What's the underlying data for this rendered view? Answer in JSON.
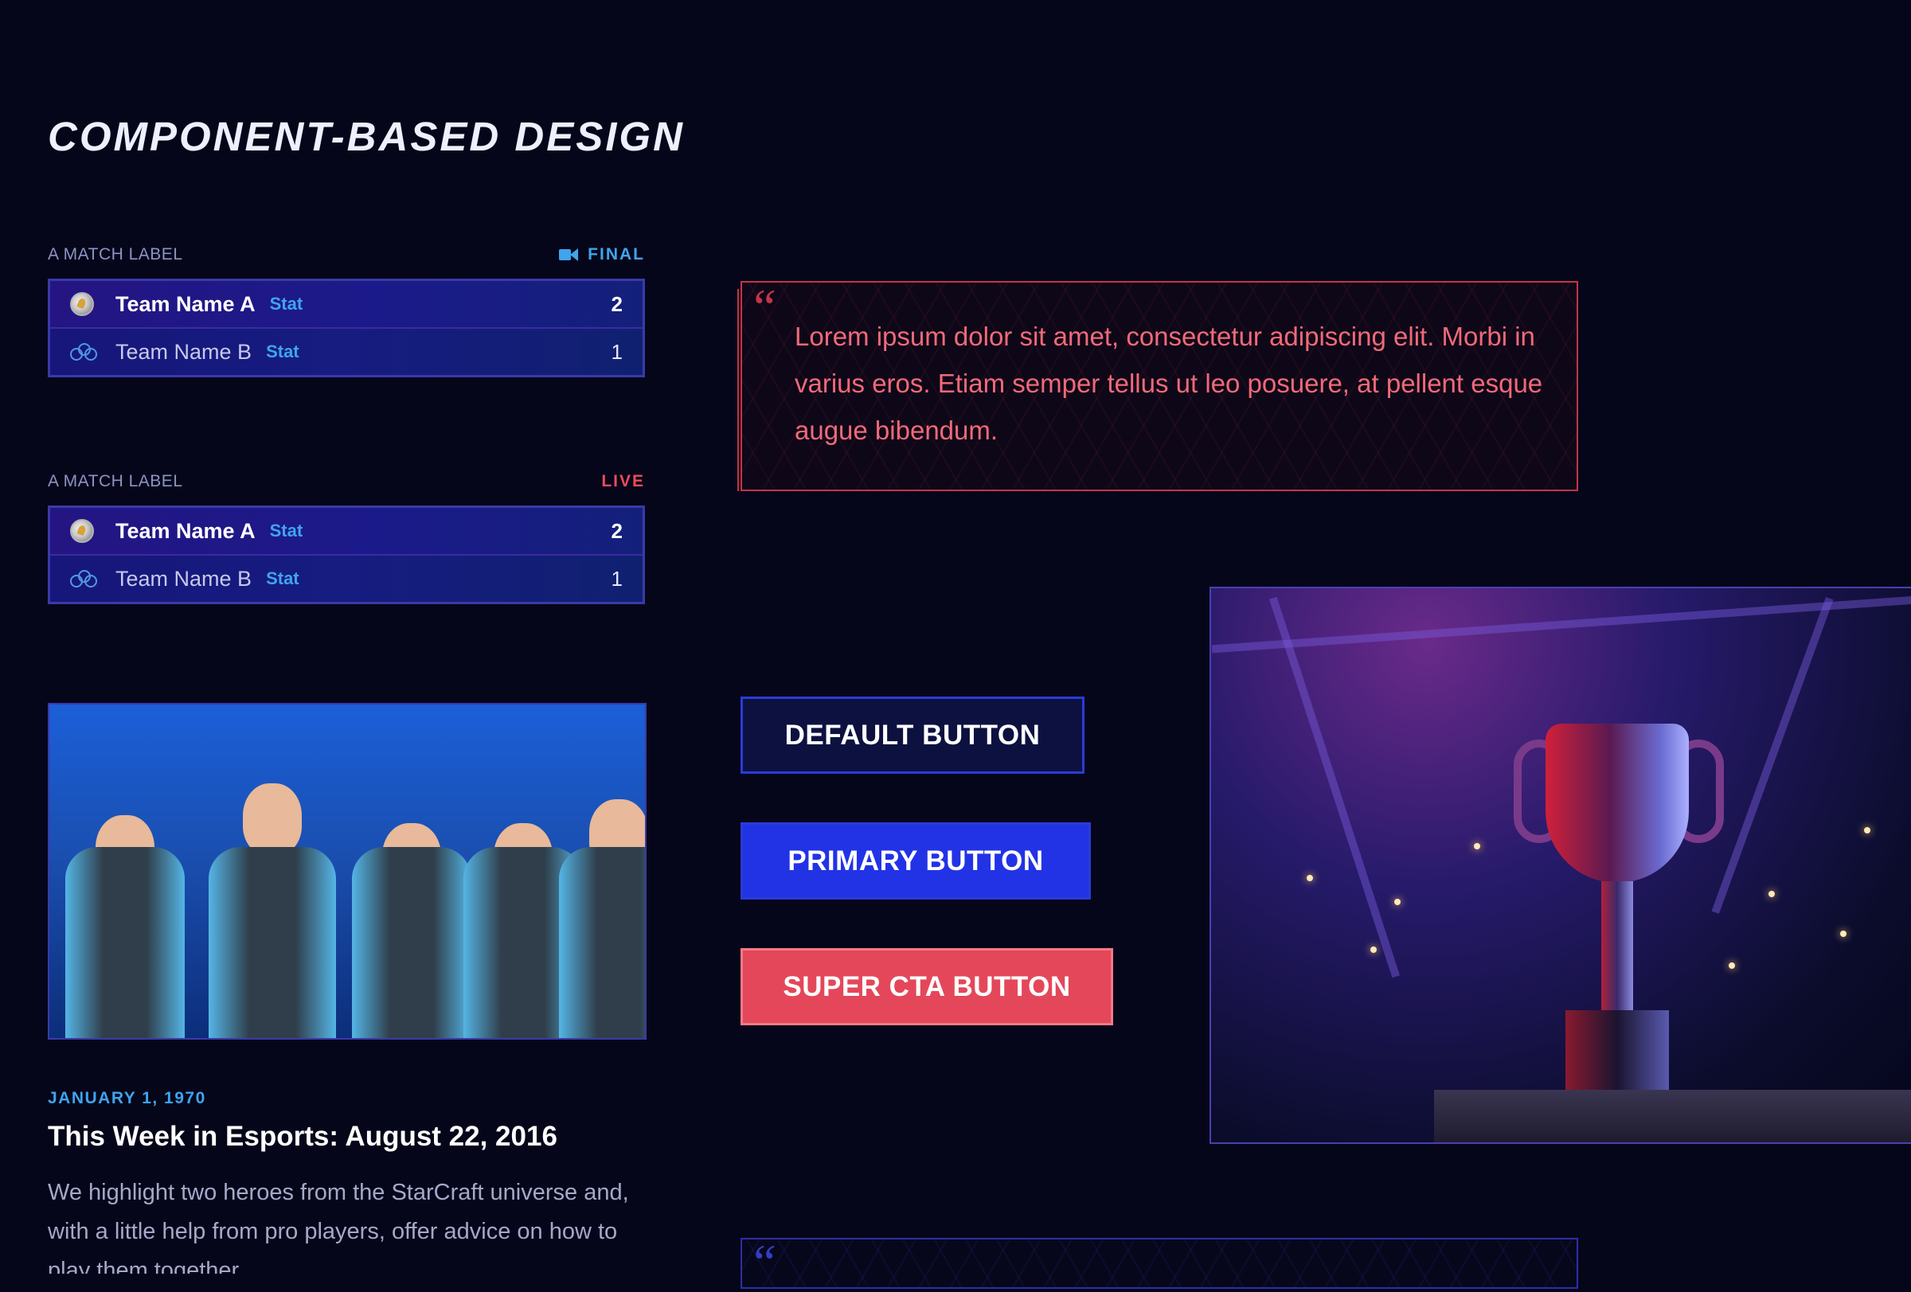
{
  "page": {
    "title": "COMPONENT-BASED DESIGN"
  },
  "matches": [
    {
      "label": "A MATCH LABEL",
      "status": "FINAL",
      "status_color": "#3fa4ee",
      "status_icon": "video-camera-icon",
      "teams": [
        {
          "name": "Team Name A",
          "stat": "Stat",
          "score": "2",
          "winner": true
        },
        {
          "name": "Team Name B",
          "stat": "Stat",
          "score": "1",
          "winner": false
        }
      ]
    },
    {
      "label": "A MATCH LABEL",
      "status": "LIVE",
      "status_color": "#ee4a5a",
      "teams": [
        {
          "name": "Team Name A",
          "stat": "Stat",
          "score": "2",
          "winner": true
        },
        {
          "name": "Team Name B",
          "stat": "Stat",
          "score": "1",
          "winner": false
        }
      ]
    }
  ],
  "article": {
    "date": "JANUARY 1, 1970",
    "title": "This Week in Esports: August 22, 2016",
    "excerpt": "We highlight two heroes from the StarCraft universe and, with a little help from pro players, offer advice on how to play them together."
  },
  "quote": {
    "text": "Lorem ipsum dolor sit amet, consectetur adipiscing elit. Morbi in varius eros. Etiam semper tellus ut leo posuere, at pellent esque augue bibendum.",
    "accent_color": "#c23646"
  },
  "buttons": {
    "default_label": "DEFAULT BUTTON",
    "primary_label": "PRIMARY BUTTON",
    "cta_label": "SUPER CTA BUTTON"
  },
  "colors": {
    "background": "#06061a",
    "accent_blue": "#3fa4ee",
    "primary": "#2233e6",
    "cta": "#e4475a",
    "card_border": "#3a3aa8"
  }
}
